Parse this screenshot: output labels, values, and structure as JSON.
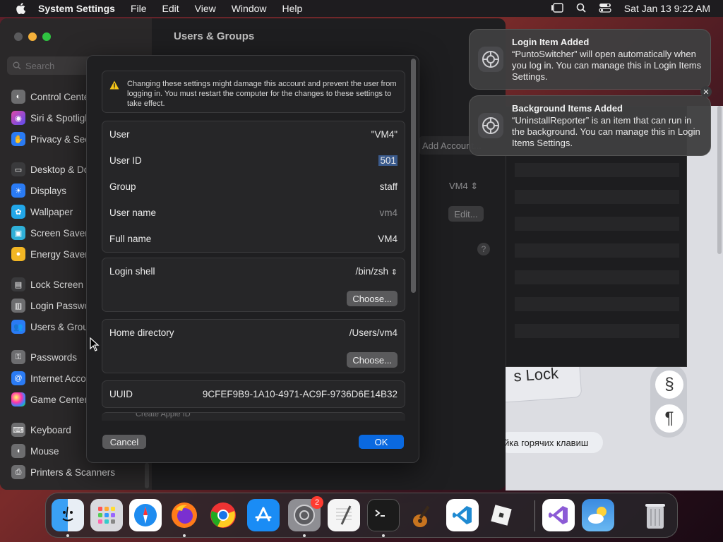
{
  "menubar": {
    "app_name": "System Settings",
    "menus": [
      "File",
      "Edit",
      "View",
      "Window",
      "Help"
    ],
    "clock": "Sat Jan 13  9:22 AM"
  },
  "settings": {
    "title": "Users & Groups",
    "search_placeholder": "Search",
    "sidebar": [
      {
        "label": "Control Center",
        "icon": "control-center-icon",
        "color": "#6d6d6f"
      },
      {
        "label": "Siri & Spotlight",
        "icon": "siri-icon",
        "color": "#b042c9"
      },
      {
        "label": "Privacy & Security",
        "icon": "hand-icon",
        "color": "#2a7bf4"
      },
      {
        "label": "Desktop & Dock",
        "icon": "desktop-icon",
        "color": "#3a3a3c"
      },
      {
        "label": "Displays",
        "icon": "displays-icon",
        "color": "#2a7bf4"
      },
      {
        "label": "Wallpaper",
        "icon": "wallpaper-icon",
        "color": "#22a7e8"
      },
      {
        "label": "Screen Saver",
        "icon": "screen-saver-icon",
        "color": "#2fb0d8"
      },
      {
        "label": "Energy Saver",
        "icon": "energy-icon",
        "color": "#f2b624"
      },
      {
        "label": "Lock Screen",
        "icon": "lock-icon",
        "color": "#3a3a3c"
      },
      {
        "label": "Login Password",
        "icon": "password-icon",
        "color": "#6d6d6f"
      },
      {
        "label": "Users & Groups",
        "icon": "users-icon",
        "color": "#2a7bf4",
        "selected": true
      },
      {
        "label": "Passwords",
        "icon": "key-icon",
        "color": "#6d6d6f"
      },
      {
        "label": "Internet Accounts",
        "icon": "at-icon",
        "color": "#2a7bf4"
      },
      {
        "label": "Game Center",
        "icon": "game-center-icon",
        "color": "#e9e9e9"
      },
      {
        "label": "Keyboard",
        "icon": "keyboard-icon",
        "color": "#6d6d6f"
      },
      {
        "label": "Mouse",
        "icon": "mouse-icon",
        "color": "#6d6d6f"
      },
      {
        "label": "Printers & Scanners",
        "icon": "printer-icon",
        "color": "#6d6d6f"
      }
    ],
    "content": {
      "add_account": "Add Account...",
      "vm_select": "VM4",
      "edit_label": "Edit...",
      "help_label": "?"
    }
  },
  "sheet": {
    "warning": "Changing these settings might damage this account and prevent the user from logging in. You must restart the computer for the changes to these settings to take effect.",
    "fields": [
      {
        "label": "User",
        "value": "\"VM4\""
      },
      {
        "label": "User ID",
        "value": "501"
      },
      {
        "label": "Group",
        "value": "staff"
      },
      {
        "label": "User name",
        "value": "vm4"
      },
      {
        "label": "Full name",
        "value": "VM4"
      }
    ],
    "login_shell": {
      "label": "Login shell",
      "value": "/bin/zsh",
      "choose": "Choose..."
    },
    "home_directory": {
      "label": "Home directory",
      "value": "/Users/vm4",
      "choose": "Choose..."
    },
    "uuid": {
      "label": "UUID",
      "value": "9CFEF9B9-1A10-4971-AC9F-9736D6E14B32"
    },
    "cut_row": "Create Apple ID",
    "cancel": "Cancel",
    "ok": "OK"
  },
  "notifications": [
    {
      "title": "Login Item Added",
      "body": "“PuntoSwitcher” will open automatically when you log in. You can manage this in Login Items Settings."
    },
    {
      "title": "Background Items Added",
      "body": "“UninstallReporter” is an item that can run in the background. You can manage this in Login Items Settings."
    }
  ],
  "background_app": {
    "caps_key": "s Lock",
    "pill": "йка горячих клавиш",
    "btn1": "§",
    "btn2": "¶"
  },
  "dock": {
    "badge": "2",
    "apps": [
      {
        "name": "finder-icon",
        "bg": "#2d8cf0",
        "dot": true
      },
      {
        "name": "launchpad-icon",
        "bg": "#d9d9de",
        "dot": false
      },
      {
        "name": "safari-icon",
        "bg": "#ffffff",
        "dot": false
      },
      {
        "name": "firefox-icon",
        "bg": "#7a2fd0",
        "dot": true
      },
      {
        "name": "chrome-icon",
        "bg": "#ffffff",
        "dot": false
      },
      {
        "name": "app-store-icon",
        "bg": "#1a8cf5",
        "dot": false
      },
      {
        "name": "system-settings-icon",
        "bg": "#8e8e93",
        "dot": true
      },
      {
        "name": "textedit-icon",
        "bg": "#f5f5f5",
        "dot": false
      },
      {
        "name": "terminal-icon",
        "bg": "#1b1b1b",
        "dot": true
      },
      {
        "name": "garageband-icon",
        "bg": "#3a2a1a",
        "dot": false
      },
      {
        "name": "vscode-icon",
        "bg": "#ffffff",
        "dot": false
      },
      {
        "name": "roblox-icon",
        "bg": "#ffffff",
        "dot": false
      },
      {
        "name": "visual-studio-icon",
        "bg": "#ffffff",
        "dot": false
      },
      {
        "name": "weather-icon",
        "bg": "#3a8ae0",
        "dot": false
      },
      {
        "name": "trash-icon",
        "bg": "transparent",
        "dot": false
      }
    ]
  }
}
